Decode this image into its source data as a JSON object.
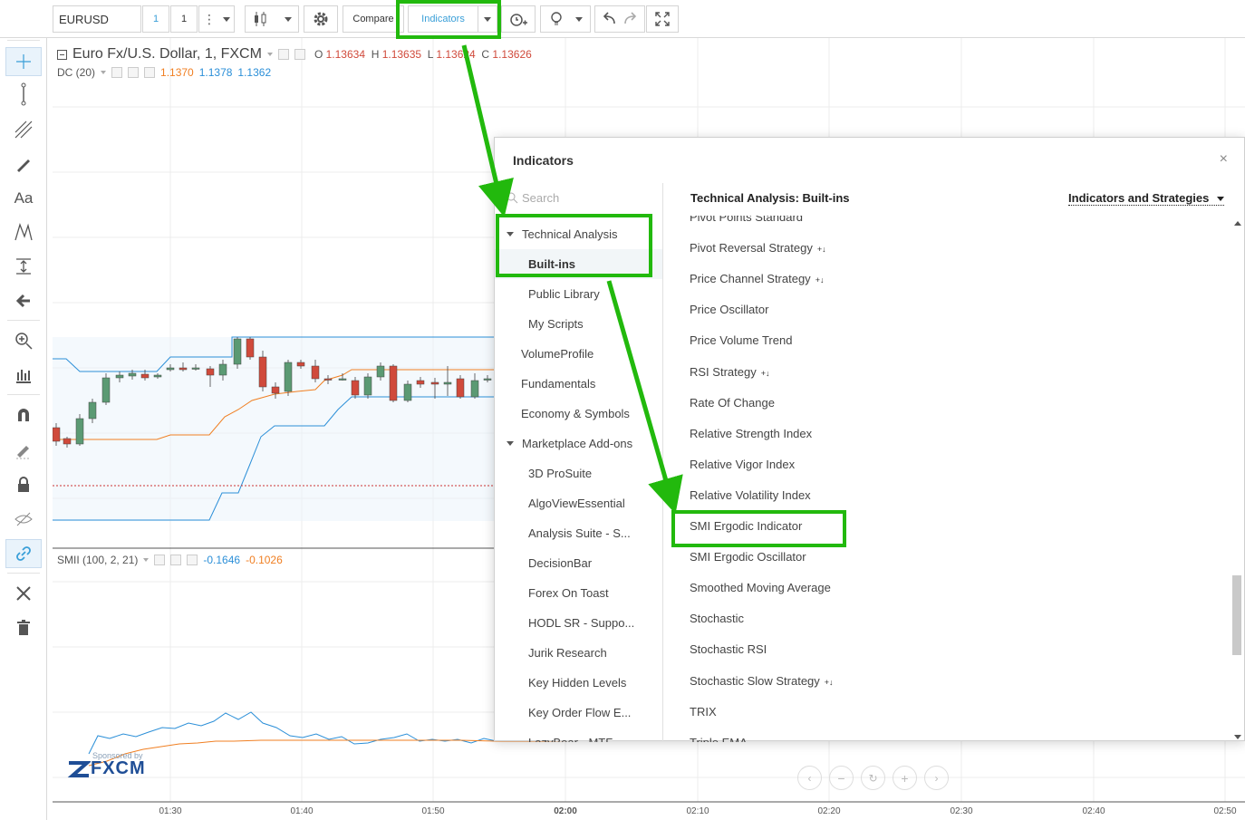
{
  "toolbar": {
    "symbol": "EURUSD",
    "interval": "1",
    "interval_alt": "1",
    "compare_label": "Compare",
    "indicators_label": "Indicators"
  },
  "legend": {
    "title": "Euro Fx/U.S. Dollar, 1, FXCM",
    "o_label": "O",
    "o_value": "1.13634",
    "h_label": "H",
    "h_value": "1.13635",
    "l_label": "L",
    "l_value": "1.13624",
    "c_label": "C",
    "c_value": "1.13626",
    "dc_label": "DC (20)",
    "dc_values": [
      "1.1370",
      "1.1378",
      "1.1362"
    ],
    "smii_label": "SMII (100, 2, 21)",
    "smii_values": [
      "-0.1646",
      "-0.1026"
    ]
  },
  "xaxis": [
    "01:30",
    "01:40",
    "01:50",
    "02:00",
    "02:10",
    "02:20",
    "02:30",
    "02:40",
    "02:50"
  ],
  "sponsor": {
    "line1": "Sponsored by",
    "brand": "FXCM"
  },
  "dialog": {
    "title": "Indicators",
    "close": "×",
    "search_placeholder": "Search",
    "categories": [
      {
        "label": "Technical Analysis",
        "caret": true,
        "indent": false
      },
      {
        "label": "Built-ins",
        "indent": true,
        "selected": true
      },
      {
        "label": "Public Library",
        "indent": true
      },
      {
        "label": "My Scripts",
        "indent": true
      },
      {
        "label": "VolumeProfile",
        "indent": false
      },
      {
        "label": "Fundamentals",
        "indent": false
      },
      {
        "label": "Economy & Symbols",
        "indent": false
      },
      {
        "label": "Marketplace Add-ons",
        "caret": true,
        "indent": false
      },
      {
        "label": "3D ProSuite",
        "indent": true
      },
      {
        "label": "AlgoViewEssential",
        "indent": true
      },
      {
        "label": "Analysis Suite - S...",
        "indent": true
      },
      {
        "label": "DecisionBar",
        "indent": true
      },
      {
        "label": "Forex On Toast",
        "indent": true
      },
      {
        "label": "HODL SR - Suppo...",
        "indent": true
      },
      {
        "label": "Jurik Research",
        "indent": true
      },
      {
        "label": "Key Hidden Levels",
        "indent": true
      },
      {
        "label": "Key Order Flow E...",
        "indent": true
      },
      {
        "label": "LazyBear - MTF",
        "indent": true
      }
    ],
    "section_header": "Technical Analysis: Built-ins",
    "filter_label": "Indicators and Strategies",
    "indicators": [
      {
        "label": "Pivot Points Standard",
        "strategy": false
      },
      {
        "label": "Pivot Reversal Strategy",
        "strategy": true
      },
      {
        "label": "Price Channel Strategy",
        "strategy": true
      },
      {
        "label": "Price Oscillator",
        "strategy": false
      },
      {
        "label": "Price Volume Trend",
        "strategy": false
      },
      {
        "label": "RSI Strategy",
        "strategy": true
      },
      {
        "label": "Rate Of Change",
        "strategy": false
      },
      {
        "label": "Relative Strength Index",
        "strategy": false
      },
      {
        "label": "Relative Vigor Index",
        "strategy": false
      },
      {
        "label": "Relative Volatility Index",
        "strategy": false
      },
      {
        "label": "SMI Ergodic Indicator",
        "strategy": false
      },
      {
        "label": "SMI Ergodic Oscillator",
        "strategy": false
      },
      {
        "label": "Smoothed Moving Average",
        "strategy": false
      },
      {
        "label": "Stochastic",
        "strategy": false
      },
      {
        "label": "Stochastic RSI",
        "strategy": false
      },
      {
        "label": "Stochastic Slow Strategy",
        "strategy": true
      },
      {
        "label": "TRIX",
        "strategy": false
      },
      {
        "label": "Triple EMA",
        "strategy": false
      }
    ],
    "strategy_marker": "+↓"
  },
  "colors": {
    "annotation_green": "#22b90d",
    "up_candle": "#5b9a73",
    "down_candle": "#d04a3b",
    "dc_upper_lower": "#2b8fd8",
    "dc_basis": "#f07f22"
  }
}
